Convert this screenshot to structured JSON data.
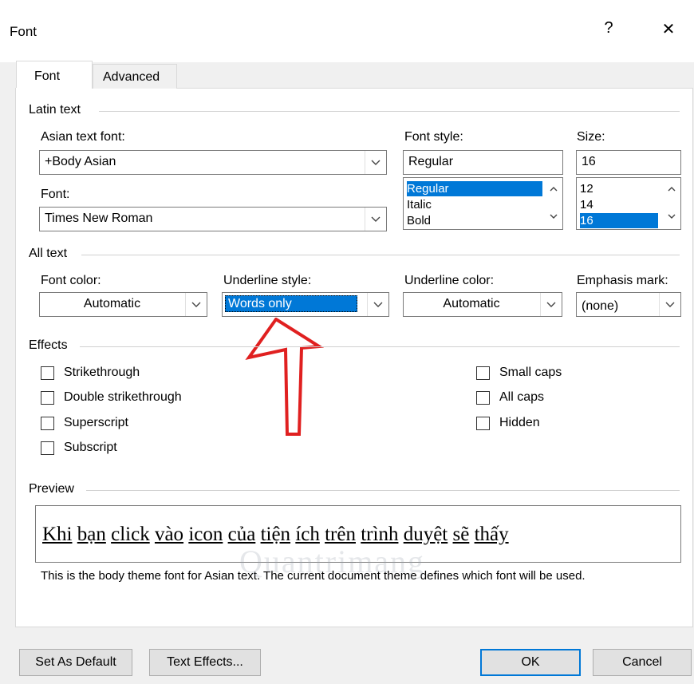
{
  "window": {
    "title": "Font",
    "help_label": "?",
    "close_label": "✕"
  },
  "tabs": [
    {
      "label": "Font",
      "active": true
    },
    {
      "label": "Advanced",
      "active": false
    }
  ],
  "latin_text": {
    "group_label": "Latin text",
    "asian_font_label": "Asian text font:",
    "asian_font_value": "+Body Asian",
    "font_label": "Font:",
    "font_value": "Times New Roman",
    "style_label": "Font style:",
    "style_value": "Regular",
    "style_options": [
      "Regular",
      "Italic",
      "Bold"
    ],
    "style_selected": "Regular",
    "size_label": "Size:",
    "size_value": "16",
    "size_options": [
      "12",
      "14",
      "16"
    ],
    "size_selected": "16"
  },
  "all_text": {
    "group_label": "All text",
    "font_color_label": "Font color:",
    "font_color_value": "Automatic",
    "underline_style_label": "Underline style:",
    "underline_style_value": "Words only",
    "underline_color_label": "Underline color:",
    "underline_color_value": "Automatic",
    "emphasis_label": "Emphasis mark:",
    "emphasis_value": "(none)"
  },
  "effects": {
    "group_label": "Effects",
    "left": [
      {
        "label": "Strikethrough",
        "checked": false
      },
      {
        "label": "Double strikethrough",
        "checked": false
      },
      {
        "label": "Superscript",
        "checked": false
      },
      {
        "label": "Subscript",
        "checked": false
      }
    ],
    "right": [
      {
        "label": "Small caps",
        "checked": false
      },
      {
        "label": "All caps",
        "checked": false
      },
      {
        "label": "Hidden",
        "checked": false
      }
    ]
  },
  "preview": {
    "group_label": "Preview",
    "words": [
      "Khi",
      "bạn",
      "click",
      "vào",
      "icon",
      "của",
      "tiện",
      "ích",
      "trên",
      "trình",
      "duyệt",
      "sẽ",
      "thấy"
    ],
    "description": "This is the body theme font for Asian text. The current document theme defines which font will be used."
  },
  "watermark": "Quantrimang",
  "buttons": {
    "set_default": "Set As Default",
    "text_effects": "Text Effects...",
    "ok": "OK",
    "cancel": "Cancel"
  },
  "colors": {
    "selection": "#0078d7",
    "annotation_arrow": "#e02020"
  },
  "icons": [
    "dropdown-arrow-icon",
    "scroll-up-icon",
    "scroll-down-icon",
    "annotation-arrow-icon"
  ]
}
